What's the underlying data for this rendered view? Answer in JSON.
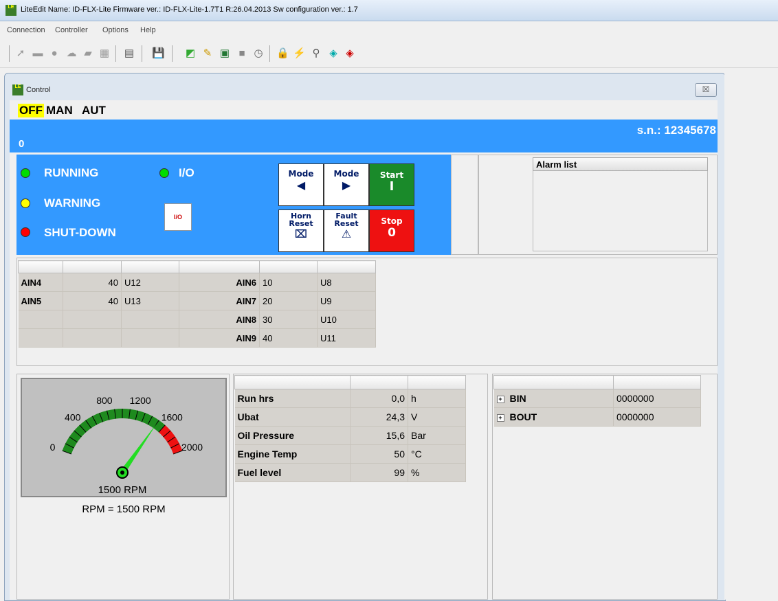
{
  "app": {
    "title": "LiteEdit Name: ID-FLX-Lite Firmware ver.: ID-FLX-Lite-1.7T1 R:26.04.2013 Sw configuration ver.: 1.7",
    "icon_text": "LE"
  },
  "menu": [
    "Connection",
    "Controller",
    "Options",
    "Help"
  ],
  "control_window": {
    "title": "Control",
    "close_glyph": "☒",
    "modes": [
      "OFF",
      "MAN",
      "AUT"
    ],
    "active_mode": "OFF",
    "serial": "s.n.: 12345678",
    "counter": "0"
  },
  "status": {
    "running": "RUNNING",
    "warning": "WARNING",
    "shutdown": "SHUT-DOWN",
    "io": "I/O",
    "io_box": "I/O",
    "colors": {
      "running": "#00dd00",
      "warning": "#ffff00",
      "shutdown": "#ff0000",
      "io": "#00dd00"
    }
  },
  "buttons": {
    "mode_left": {
      "label": "Mode",
      "glyph": "◀"
    },
    "mode_right": {
      "label": "Mode",
      "glyph": "▶"
    },
    "start": {
      "label": "Start",
      "glyph": "I"
    },
    "horn_reset": {
      "label": "Horn Reset",
      "glyph": "⌧"
    },
    "fault_reset": {
      "label": "Fault Reset",
      "glyph": "⚠"
    },
    "stop": {
      "label": "Stop",
      "glyph": "0"
    }
  },
  "alarm_list": {
    "header": "Alarm list"
  },
  "analog": {
    "rows": [
      [
        "AIN4",
        "40",
        "U12",
        "AIN6",
        "10",
        "U8"
      ],
      [
        "AIN5",
        "40",
        "U13",
        "AIN7",
        "20",
        "U9"
      ],
      [
        "",
        "",
        "",
        "AIN8",
        "30",
        "U10"
      ],
      [
        "",
        "",
        "",
        "AIN9",
        "40",
        "U11"
      ]
    ]
  },
  "gauge": {
    "ticks": [
      "0",
      "400",
      "800",
      "1200",
      "1600",
      "2000"
    ],
    "value": 1500,
    "min": 0,
    "max": 2000,
    "red_from": 1600,
    "readout": "1500 RPM",
    "equation": "RPM = 1500 RPM"
  },
  "values": [
    {
      "name": "Run hrs",
      "value": "0,0",
      "unit": "h"
    },
    {
      "name": "Ubat",
      "value": "24,3",
      "unit": "V"
    },
    {
      "name": "Oil Pressure",
      "value": "15,6",
      "unit": "Bar"
    },
    {
      "name": "Engine Temp",
      "value": "50",
      "unit": "°C"
    },
    {
      "name": "Fuel level",
      "value": "99",
      "unit": "%"
    }
  ],
  "binary": [
    {
      "name": "BIN",
      "value": "0000000"
    },
    {
      "name": "BOUT",
      "value": "0000000"
    }
  ]
}
